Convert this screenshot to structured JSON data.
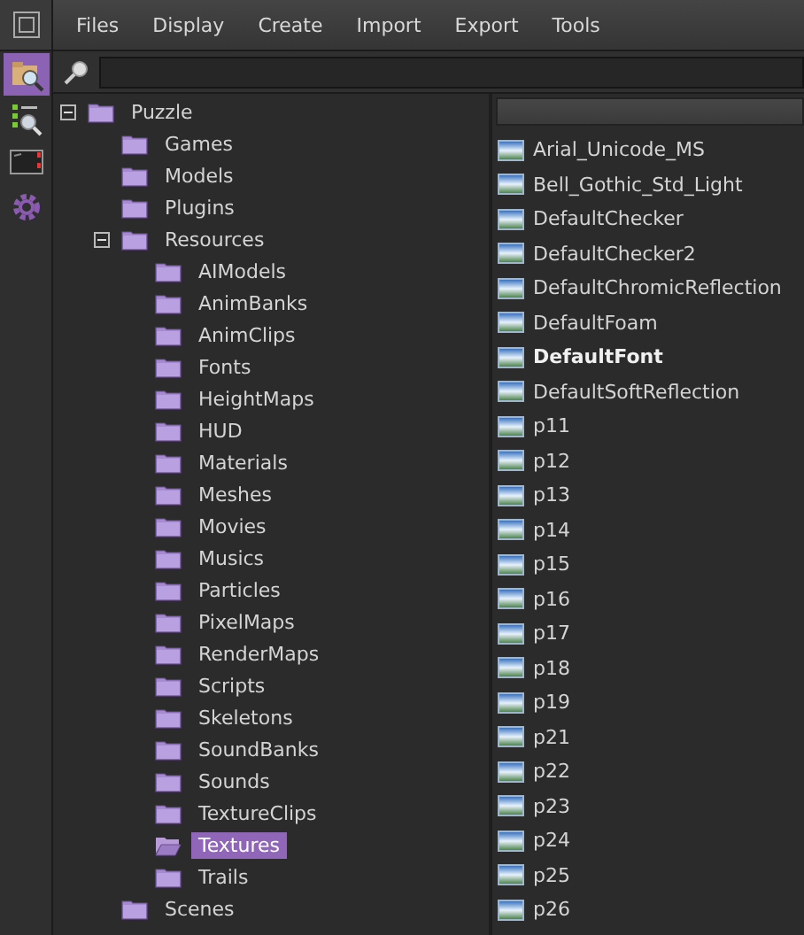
{
  "menu_bar": {
    "items": [
      "Files",
      "Display",
      "Create",
      "Import",
      "Export",
      "Tools"
    ]
  },
  "toolbar": [
    {
      "kind": "browser",
      "selected": true
    },
    {
      "kind": "list-search",
      "selected": false
    },
    {
      "kind": "monitor",
      "selected": false
    },
    {
      "kind": "gear",
      "selected": false
    }
  ],
  "tree": [
    {
      "label": "Puzzle",
      "expanded": true,
      "selected": false,
      "children": [
        {
          "label": "Games",
          "selected": false
        },
        {
          "label": "Models",
          "selected": false
        },
        {
          "label": "Plugins",
          "selected": false
        },
        {
          "label": "Resources",
          "expanded": true,
          "selected": false,
          "children": [
            {
              "label": "AIModels",
              "selected": false
            },
            {
              "label": "AnimBanks",
              "selected": false
            },
            {
              "label": "AnimClips",
              "selected": false
            },
            {
              "label": "Fonts",
              "selected": false
            },
            {
              "label": "HeightMaps",
              "selected": false
            },
            {
              "label": "HUD",
              "selected": false
            },
            {
              "label": "Materials",
              "selected": false
            },
            {
              "label": "Meshes",
              "selected": false
            },
            {
              "label": "Movies",
              "selected": false
            },
            {
              "label": "Musics",
              "selected": false
            },
            {
              "label": "Particles",
              "selected": false
            },
            {
              "label": "PixelMaps",
              "selected": false
            },
            {
              "label": "RenderMaps",
              "selected": false
            },
            {
              "label": "Scripts",
              "selected": false
            },
            {
              "label": "Skeletons",
              "selected": false
            },
            {
              "label": "SoundBanks",
              "selected": false
            },
            {
              "label": "Sounds",
              "selected": false
            },
            {
              "label": "TextureClips",
              "selected": false
            },
            {
              "label": "Textures",
              "selected": true
            },
            {
              "label": "Trails",
              "selected": false
            }
          ]
        },
        {
          "label": "Scenes",
          "selected": false
        }
      ]
    }
  ],
  "files": [
    {
      "label": "Arial_Unicode_MS",
      "bold": false
    },
    {
      "label": "Bell_Gothic_Std_Light",
      "bold": false
    },
    {
      "label": "DefaultChecker",
      "bold": false
    },
    {
      "label": "DefaultChecker2",
      "bold": false
    },
    {
      "label": "DefaultChromicReflection",
      "bold": false
    },
    {
      "label": "DefaultFoam",
      "bold": false
    },
    {
      "label": "DefaultFont",
      "bold": true
    },
    {
      "label": "DefaultSoftReflection",
      "bold": false
    },
    {
      "label": "p11",
      "bold": false
    },
    {
      "label": "p12",
      "bold": false
    },
    {
      "label": "p13",
      "bold": false
    },
    {
      "label": "p14",
      "bold": false
    },
    {
      "label": "p15",
      "bold": false
    },
    {
      "label": "p16",
      "bold": false
    },
    {
      "label": "p17",
      "bold": false
    },
    {
      "label": "p18",
      "bold": false
    },
    {
      "label": "p19",
      "bold": false
    },
    {
      "label": "p21",
      "bold": false
    },
    {
      "label": "p22",
      "bold": false
    },
    {
      "label": "p23",
      "bold": false
    },
    {
      "label": "p24",
      "bold": false
    },
    {
      "label": "p25",
      "bold": false
    },
    {
      "label": "p26",
      "bold": false
    }
  ]
}
